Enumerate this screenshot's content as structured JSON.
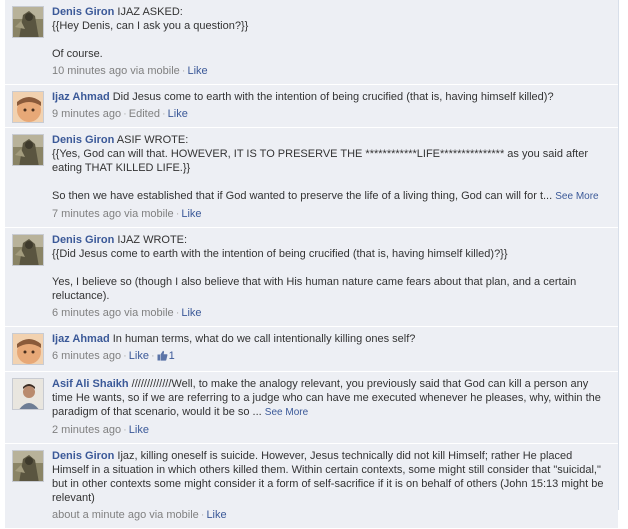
{
  "comments": [
    {
      "author": "Denis Giron",
      "text": "IJAZ ASKED:\n{{Hey Denis, can I ask you a question?}}\n\nOf course.",
      "time": "10 minutes ago via mobile",
      "like": "Like"
    },
    {
      "author": "Ijaz Ahmad",
      "text": "Did Jesus come to earth with the intention of being crucified (that is, having himself killed)?",
      "time": "9 minutes ago",
      "edited": "Edited",
      "like": "Like"
    },
    {
      "author": "Denis Giron",
      "text": "ASIF WROTE:\n{{Yes, God can will that. HOWEVER, IT IS TO PRESERVE THE ************LIFE*************** as you said after eating THAT KILLED LIFE.}}\n\nSo then we have established that if God wanted to preserve the life of a living thing, God can will for t...",
      "see_more": "See More",
      "time": "7 minutes ago via mobile",
      "like": "Like"
    },
    {
      "author": "Denis Giron",
      "text": "IJAZ WROTE:\n{{Did Jesus come to earth with the intention of being crucified (that is, having himself killed)?}}\n\nYes, I believe so (though I also believe that with His human nature came fears about that plan, and a certain reluctance).",
      "time": "6 minutes ago via mobile",
      "like": "Like"
    },
    {
      "author": "Ijaz Ahmad",
      "text": "In human terms, what do we call intentionally killing ones self?",
      "time": "6 minutes ago",
      "like": "Like",
      "like_count": "1"
    },
    {
      "author": "Asif Ali Shaikh",
      "text": "/////////////Well, to make the analogy relevant, you previously said that God can kill a person any time He wants, so if we are referring to a judge who can have me executed whenever he pleases, why, within the paradigm of that scenario, would it be so ...",
      "see_more": "See More",
      "time": "2 minutes ago",
      "like": "Like"
    },
    {
      "author": "Denis Giron",
      "text": "Ijaz, killing oneself is suicide. However, Jesus technically did not kill Himself; rather He placed Himself in a situation in which others killed them. Within certain contexts, some might still consider that \"suicidal,\" but in other contexts some might consider it a form of self-sacrifice if it is on behalf of others (John 15:13 might be relevant)",
      "time": "about a minute ago via mobile",
      "like": "Like"
    }
  ],
  "separator": "·"
}
